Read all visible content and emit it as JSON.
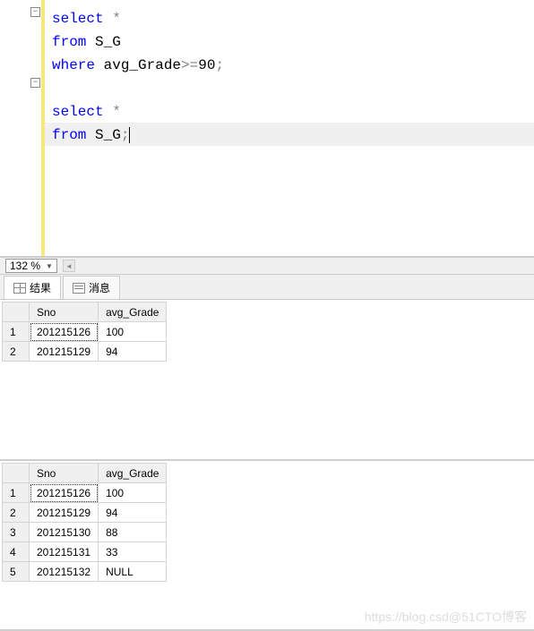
{
  "editor": {
    "query1": {
      "l1_kw": "select",
      "l1_op": " *",
      "l2_kw": "from",
      "l2_txt": " S_G",
      "l3_kw": "where",
      "l3_txt": " avg_Grade",
      "l3_op": ">=",
      "l3_num": "90",
      "l3_semi": ";"
    },
    "query2": {
      "l1_kw": "select",
      "l1_op": " *",
      "l2_kw": "from",
      "l2_txt": " S_G",
      "l2_semi": ";"
    }
  },
  "zoom": {
    "level": "132 %"
  },
  "tabs": {
    "results": "结果",
    "messages": "消息"
  },
  "table1": {
    "headers": {
      "c1": "Sno",
      "c2": "avg_Grade"
    },
    "rows": [
      {
        "n": "1",
        "sno": "201215126",
        "g": "100"
      },
      {
        "n": "2",
        "sno": "201215129",
        "g": "94"
      }
    ]
  },
  "table2": {
    "headers": {
      "c1": "Sno",
      "c2": "avg_Grade"
    },
    "rows": [
      {
        "n": "1",
        "sno": "201215126",
        "g": "100"
      },
      {
        "n": "2",
        "sno": "201215129",
        "g": "94"
      },
      {
        "n": "3",
        "sno": "201215130",
        "g": "88"
      },
      {
        "n": "4",
        "sno": "201215131",
        "g": "33"
      },
      {
        "n": "5",
        "sno": "201215132",
        "g": "NULL"
      }
    ]
  },
  "watermark": "https://blog.csd@51CTO博客"
}
